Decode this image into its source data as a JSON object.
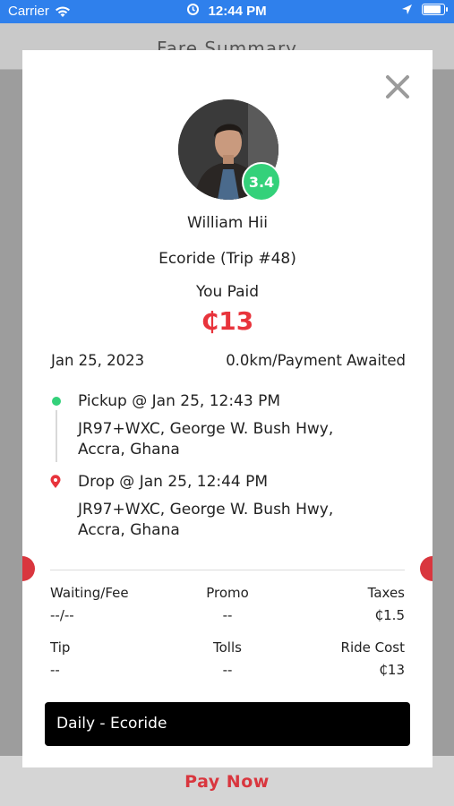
{
  "status_bar": {
    "carrier": "Carrier",
    "time": "12:44 PM",
    "battery_level": 0.9
  },
  "background_screen": {
    "title": "Fare Summary",
    "pay_now_label": "Pay Now"
  },
  "modal": {
    "driver_name": "William Hii",
    "driver_rating": "3.4",
    "vehicle_trip": "Ecoride (Trip #48)",
    "paid_label": "You Paid",
    "amount": "₵13",
    "date": "Jan 25, 2023",
    "distance_status": "0.0km/Payment Awaited",
    "pickup": {
      "title": "Pickup @ Jan 25, 12:43 PM",
      "address": "JR97+WXC, George W. Bush Hwy, Accra, Ghana"
    },
    "drop": {
      "title": "Drop @ Jan 25, 12:44 PM",
      "address": "JR97+WXC, George W. Bush Hwy, Accra, Ghana"
    },
    "fare": {
      "waiting_fee_label": "Waiting/Fee",
      "waiting_fee_value": "--/--",
      "promo_label": "Promo",
      "promo_value": "--",
      "taxes_label": "Taxes",
      "taxes_value": "₵1.5",
      "tip_label": "Tip",
      "tip_value": "--",
      "tolls_label": "Tolls",
      "tolls_value": "--",
      "ride_cost_label": "Ride Cost",
      "ride_cost_value": "₵13"
    },
    "ride_type": "Daily - Ecoride"
  },
  "colors": {
    "status_bar": "#2f80ec",
    "accent_red": "#e8343c",
    "rating_green": "#34d17a",
    "ride_type_bar": "#000000"
  }
}
